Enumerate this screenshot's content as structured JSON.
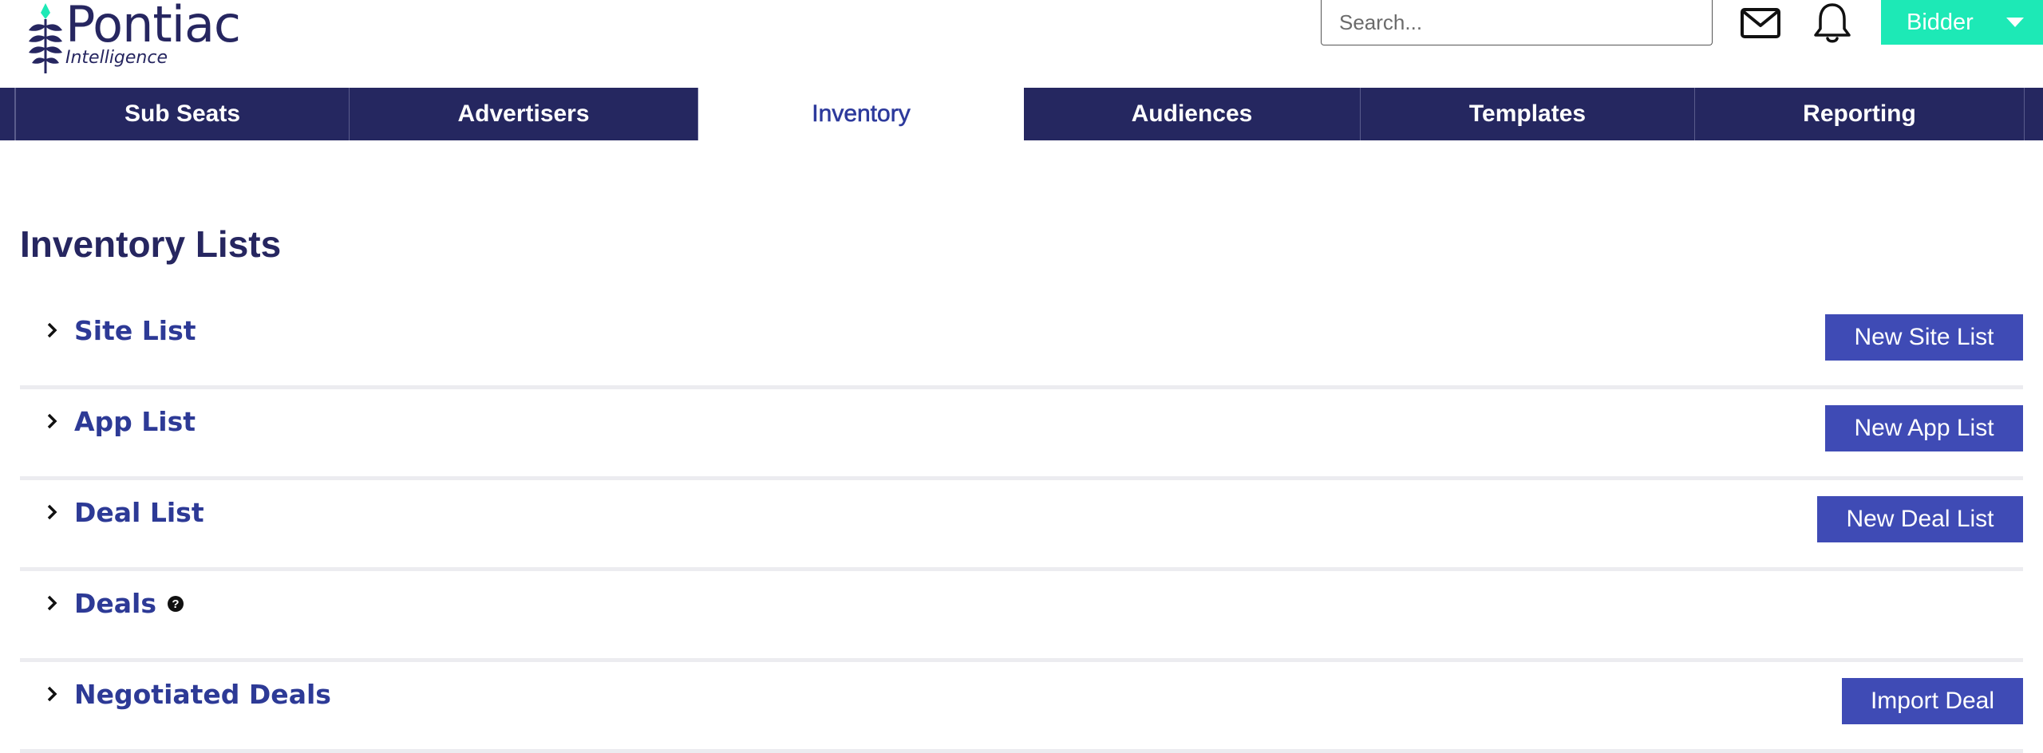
{
  "header": {
    "logo_name": "Pontiac",
    "logo_sub": "Intelligence",
    "search": {
      "placeholder": "Search...",
      "value": ""
    },
    "mail_icon": "mail-icon",
    "bell_icon": "bell-icon",
    "bidder_label": "Bidder",
    "accent_color": "#1de9b6"
  },
  "nav": {
    "items": [
      {
        "label": "Sub Seats",
        "active": false
      },
      {
        "label": "Advertisers",
        "active": false
      },
      {
        "label": "Inventory",
        "active": true
      },
      {
        "label": "Audiences",
        "active": false
      },
      {
        "label": "Templates",
        "active": false
      },
      {
        "label": "Reporting",
        "active": false
      }
    ],
    "background_color": "#252760"
  },
  "main": {
    "title": "Inventory Lists",
    "sections": [
      {
        "label": "Site List",
        "button": "New Site List"
      },
      {
        "label": "App List",
        "button": "New App List"
      },
      {
        "label": "Deal List",
        "button": "New Deal List"
      },
      {
        "label": "Deals",
        "help_icon": "help-icon"
      },
      {
        "label": "Negotiated Deals",
        "button": "Import Deal"
      }
    ],
    "button_color": "#3f4bb5"
  }
}
